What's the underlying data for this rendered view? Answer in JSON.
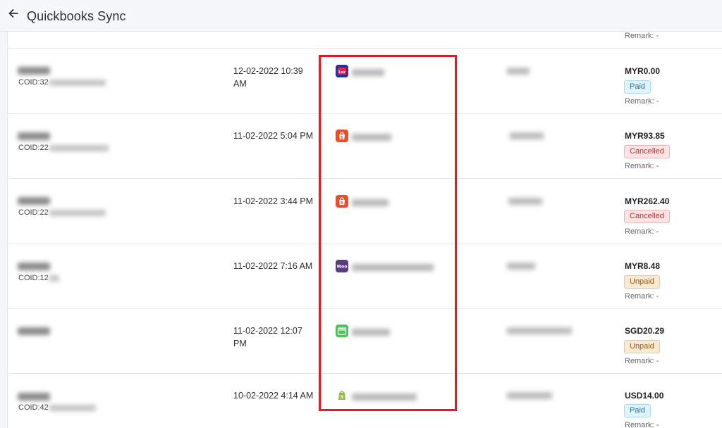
{
  "header": {
    "title": "Quickbooks Sync",
    "back_icon": "arrow-left-icon"
  },
  "top_partial_row": {
    "remark": "Remark: -"
  },
  "rows": [
    {
      "coid": "COID:32",
      "date_line1": "12-02-2022 10:39",
      "date_line2": "AM",
      "platform_icon": "lazada-icon",
      "platform_color": "#2b3a9e",
      "amount": "MYR0.00",
      "status": "Paid",
      "remark": "Remark: -"
    },
    {
      "coid": "COID:22",
      "date_line1": "11-02-2022 5:04 PM",
      "date_line2": "",
      "platform_icon": "shopee-icon",
      "platform_color": "#ee4d2d",
      "amount": "MYR93.85",
      "status": "Cancelled",
      "remark": "Remark: -"
    },
    {
      "coid": "COID:22",
      "date_line1": "11-02-2022 3:44 PM",
      "date_line2": "",
      "platform_icon": "shopee-icon",
      "platform_color": "#ee4d2d",
      "amount": "MYR262.40",
      "status": "Cancelled",
      "remark": "Remark: -"
    },
    {
      "coid": "COID:12",
      "date_line1": "11-02-2022 7:16 AM",
      "date_line2": "",
      "platform_icon": "woocommerce-icon",
      "platform_color": "#5b3b7f",
      "amount": "MYR8.48",
      "status": "Unpaid",
      "remark": "Remark: -"
    },
    {
      "coid": "",
      "date_line1": "11-02-2022 12:07",
      "date_line2": "PM",
      "platform_icon": "store-icon",
      "platform_color": "#4cc35a",
      "amount": "SGD20.29",
      "status": "Unpaid",
      "remark": "Remark: -"
    },
    {
      "coid": "COID:42",
      "date_line1": "10-02-2022 4:14 AM",
      "date_line2": "",
      "platform_icon": "shopify-icon",
      "platform_color": "#95bf47",
      "amount": "USD14.00",
      "status": "Paid",
      "remark": "Remark: -"
    }
  ],
  "colors": {
    "highlight": "#e01b22",
    "paid_badge": "#dff3fb",
    "cancelled_badge": "#fde3e3",
    "unpaid_badge": "#fde9d2"
  }
}
